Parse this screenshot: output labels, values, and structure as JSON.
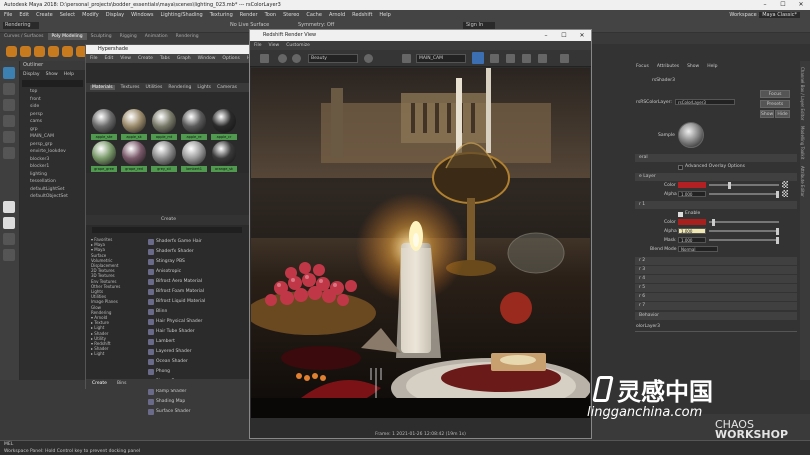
{
  "titlebar": {
    "title": "Autodesk Maya 2018: D:\\personal_projects\\bodder_essentials\\maya\\scenes\\lighting_023.mb* --- rsColorLayer3",
    "minimize": "–",
    "maximize": "☐",
    "close": "✕"
  },
  "menubar": {
    "items": [
      "File",
      "Edit",
      "Create",
      "Select",
      "Modify",
      "Display",
      "Windows",
      "Lighting/Shading",
      "Texturing",
      "Render",
      "Toon",
      "Stereo",
      "Cache",
      "Arnold",
      "Redshift",
      "Help"
    ],
    "workspace_label": "Workspace :",
    "workspace_value": "Maya Classic*"
  },
  "statusline": {
    "mode": "Rendering",
    "snap_label": "No Live Surface",
    "symmetry": "Symmetry: Off",
    "signin": "Sign In"
  },
  "shelf": {
    "tabs": [
      "Curves / Surfaces",
      "Poly Modeling",
      "Sculpting",
      "Rigging",
      "Animation",
      "Rendering"
    ],
    "active": 1
  },
  "outliner": {
    "title": "Outliner",
    "menu": [
      "Display",
      "Show",
      "Help"
    ],
    "items": [
      "top",
      "front",
      "side",
      "persp",
      "cams",
      "grp",
      "MAIN_CAM",
      "persp_grp",
      "envirte_lookdev",
      "blocker3",
      "blocker1",
      "lighting",
      "tessellation",
      "defaultLightSet",
      "defaultObjectSet"
    ]
  },
  "hypershade": {
    "title": "Hypershade",
    "menu": [
      "File",
      "Edit",
      "View",
      "Create",
      "Tabs",
      "Graph",
      "Window",
      "Options",
      "Help"
    ],
    "swatch_tabs": [
      "Materials",
      "Textures",
      "Utilities",
      "Rendering",
      "Lights",
      "Cameras"
    ],
    "swatch_labels": [
      "apple_ste",
      "apple_sk",
      "apple_mt",
      "apple_re",
      "apple_cr",
      "grape_gree",
      "grape_red",
      "grey_stl",
      "lambert1",
      "orange_sk"
    ],
    "swatch_colors": [
      "#6a6a6a",
      "#9a8a6a",
      "#7a7a6a",
      "#5a5a5a",
      "#2a2a2a",
      "#7a9a6a",
      "#7a5a6a",
      "#8a8a8a",
      "#9a9a9a",
      "#3a3a3a"
    ],
    "create_label": "Create",
    "categories": [
      "▾ Favorites",
      "  ▸ Maya",
      "▾ Maya",
      "   Surface",
      "   Volumetric",
      "   Displacement",
      "   2D Textures",
      "   3D Textures",
      "   Env Textures",
      "   Other Textures",
      "   Lights",
      "   Utilities",
      "   Image Planes",
      "   Glow",
      "   Rendering",
      "▾ Arnold",
      "  ▸ Texture",
      "  ▸ Light",
      "  ▸ Shader",
      "  ▸ Utility",
      "▾ Redshift",
      "  ▸ Shader",
      "  ▸ Light"
    ],
    "shaders": [
      "Shaderfx Game Hair",
      "Shaderfx Shader",
      "Stingray PBS",
      "Anisotropic",
      "Bifrost Aero Material",
      "Bifrost Foam Material",
      "Bifrost Liquid Material",
      "Blinn",
      "Hair Physical Shader",
      "Hair Tube Shader",
      "Lambert",
      "Layered Shader",
      "Ocean Shader",
      "Phong",
      "Phong E",
      "Ramp Shader",
      "Shading Map",
      "Surface Shader"
    ],
    "bottom_tabs": [
      "Create",
      "Bins"
    ]
  },
  "render_view": {
    "title": "Redshift Render View",
    "menu": [
      "File",
      "View",
      "Customize"
    ],
    "aov": "Beauty",
    "camera": "MAIN_CAM",
    "status": "Frame: 1   2021-01-26  12:08:42   (19m 1s)",
    "minimize": "–",
    "maximize": "☐",
    "close": "✕"
  },
  "attribute_editor": {
    "tabs": [
      "Focus",
      "Attributes",
      "Show",
      "Help"
    ],
    "node_tab": "rsShader3",
    "node_label": "rsRSColorLayer:",
    "node_value": "rsColorLayer3",
    "focus_btn": "Focus",
    "presets_btn": "Presets",
    "show_btn": "Show",
    "hide_btn": "Hide",
    "sample_label": "Sample",
    "section_general": "eral",
    "advanced_overlay": "Advanced Overlay Options",
    "section_base": "e Layer",
    "color_label": "Color",
    "alpha_label": "Alpha",
    "alpha_value": "1.000",
    "section_layer1": "r 1",
    "enable_label": "Enable",
    "layer_color_label": "Color",
    "layer_alpha_label": "Alpha",
    "layer_alpha_value": "1.000",
    "mask_label": "Mask",
    "mask_value": "1.000",
    "blend_label": "Blend Mode",
    "blend_value": "Normal",
    "layers": [
      "r 2",
      "r 3",
      "r 4",
      "r 5",
      "r 6",
      "r 7"
    ],
    "section_behavior": "Behavior",
    "footer_node": "olorLayer3",
    "colors": {
      "base_color": "#b32024",
      "layer_color": "#a8201e",
      "alpha_color": "#f0e8b0"
    }
  },
  "helpline": {
    "line1": "MEL",
    "line2": "Workspace Panel: Hold Control key to prevent docking panel"
  },
  "watermark": {
    "cn": "灵感中国",
    "domain": "lingganchina.com",
    "ws1": "CHAOS",
    "ws2": "WORKSHOP"
  },
  "right_strip": [
    "Channel Box / Layer Editor",
    "Modelling Toolkit",
    "Attribute Editor"
  ]
}
